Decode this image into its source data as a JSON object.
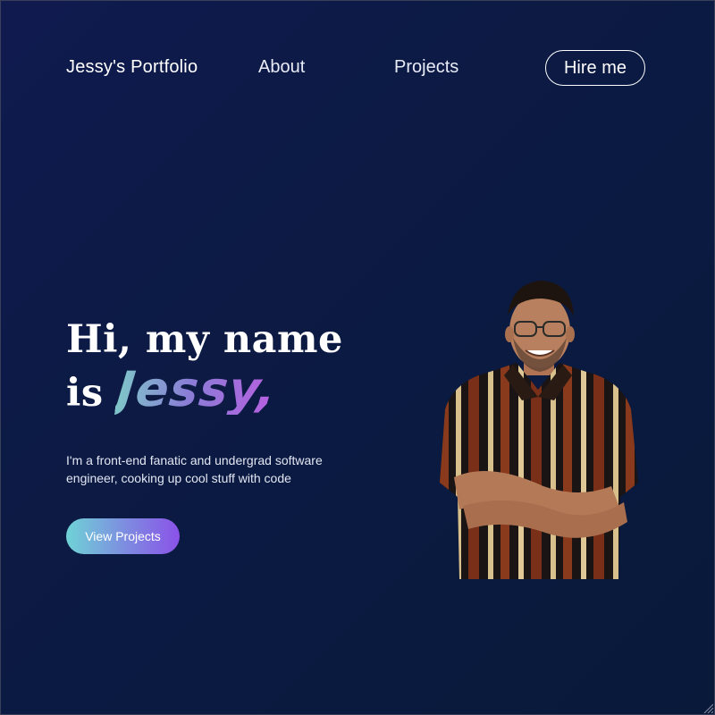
{
  "nav": {
    "brand": "Jessy's Portfolio",
    "about": "About",
    "projects": "Projects",
    "hire": "Hire me"
  },
  "hero": {
    "line1": "Hi, my name",
    "line2_prefix": "is",
    "name": "Jessy,",
    "tagline": "I'm a front-end fanatic and undergrad software engineer, cooking up cool stuff with code",
    "cta": "View Projects"
  },
  "colors": {
    "background": "#0b1a44",
    "accent_teal": "#6fd3d6",
    "accent_purple": "#8a52e8",
    "text": "#ffffff"
  },
  "icons": {
    "portrait": "person-portrait",
    "resize": "resize-grip-icon"
  }
}
